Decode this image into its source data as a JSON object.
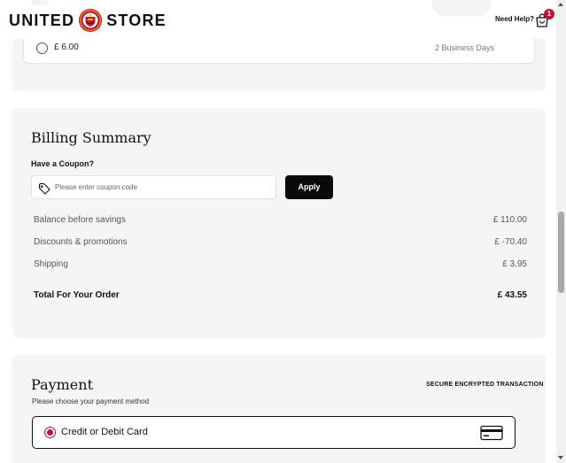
{
  "header": {
    "logo_left": "UNITED",
    "logo_right": "STORE",
    "logo_icon": "club-crest-icon",
    "need_help": "Need Help?",
    "cart_icon": "shopping-bag-icon",
    "cart_count": "1"
  },
  "shipping": {
    "option_price": "£ 6.00",
    "option_eta": "2 Business Days"
  },
  "billing": {
    "title": "Billing Summary",
    "coupon_label": "Have a Coupon?",
    "coupon_placeholder": "Please enter coupon code",
    "coupon_icon": "tag-icon",
    "apply_label": "Apply",
    "rows": [
      {
        "label": "Balance before savings",
        "value": "£ 110.00"
      },
      {
        "label": "Discounts & promotions",
        "value": "£ -70.40"
      },
      {
        "label": "Shipping",
        "value": "£ 3.95"
      }
    ],
    "total": {
      "label": "Total For Your Order",
      "value": "£ 43.55"
    }
  },
  "payment": {
    "title": "Payment",
    "secure_label": "SECURE ENCRYPTED TRANSACTION",
    "subtitle": "Please choose your payment method",
    "option_label": "Credit or Debit Card",
    "option_icon": "credit-card-icon"
  },
  "colors": {
    "accent": "#c8102e",
    "button": "#0a0a0a",
    "panel": "#f5f5f5"
  }
}
